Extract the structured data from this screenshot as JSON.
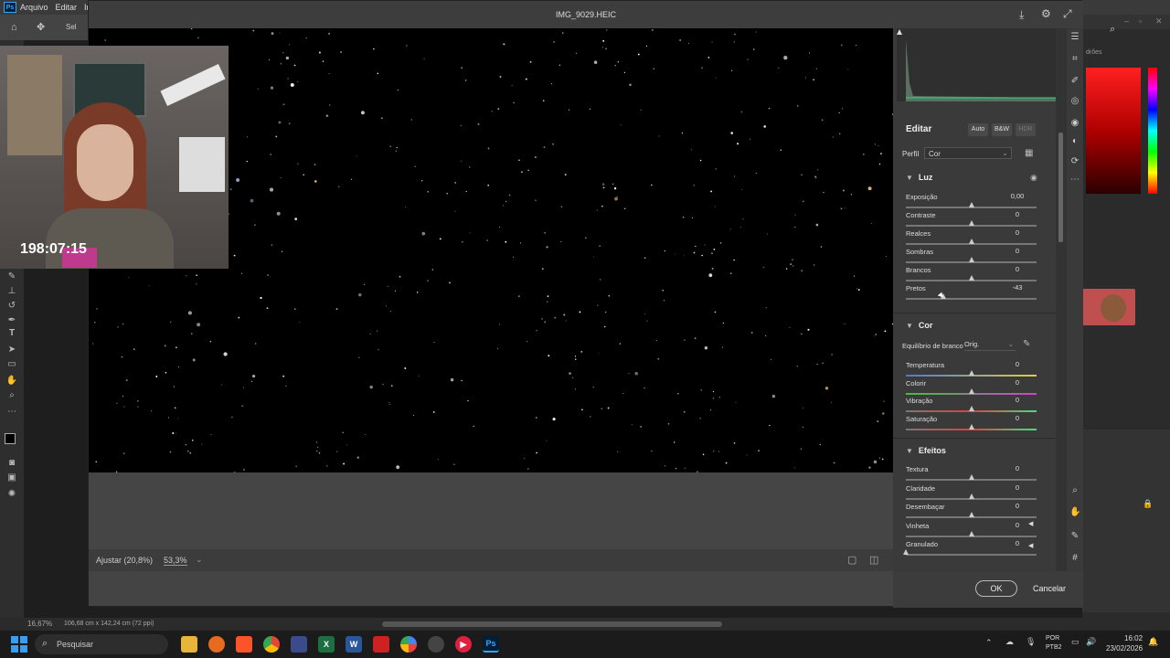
{
  "ps_menu": {
    "logo": "Ps",
    "items": [
      "Arquivo",
      "Editar",
      "Im"
    ]
  },
  "ps_optbar": {
    "sel_label": "Sel"
  },
  "ps_status": {
    "zoom": "16,67%",
    "doc_size": "106,68 cm x 142,24 cm (72 ppi)"
  },
  "dialog": {
    "title": "IMG_9029.HEIC",
    "zoom_fit": "Ajustar (20,8%)",
    "zoom_value": "53,3%",
    "ok_label": "OK",
    "cancel_label": "Cancelar"
  },
  "edit_panel": {
    "title": "Editar",
    "buttons": [
      "Auto",
      "B&W",
      "HDR"
    ],
    "profile_label": "Perfil",
    "profile_value": "Cor",
    "sections": [
      {
        "title": "Luz",
        "sliders": [
          {
            "label": "Exposição",
            "value": "0,00",
            "pos": 0.5
          },
          {
            "label": "Contraste",
            "value": "0",
            "pos": 0.5
          },
          {
            "label": "Realces",
            "value": "0",
            "pos": 0.5
          },
          {
            "label": "Sombras",
            "value": "0",
            "pos": 0.5
          },
          {
            "label": "Brancos",
            "value": "0",
            "pos": 0.5
          },
          {
            "label": "Pretos",
            "value": "-43",
            "pos": 0.285
          }
        ]
      },
      {
        "title": "Cor",
        "wb_label": "Equilíbrio de branco",
        "wb_value": "Orig.",
        "sliders": [
          {
            "label": "Temperatura",
            "value": "0",
            "pos": 0.5
          },
          {
            "label": "Colorir",
            "value": "0",
            "pos": 0.5
          },
          {
            "label": "Vibração",
            "value": "0",
            "pos": 0.5
          },
          {
            "label": "Saturação",
            "value": "0",
            "pos": 0.5
          }
        ]
      },
      {
        "title": "Efeitos",
        "sliders": [
          {
            "label": "Textura",
            "value": "0",
            "pos": 0.5
          },
          {
            "label": "Claridade",
            "value": "0",
            "pos": 0.5
          },
          {
            "label": "Desembaçar",
            "value": "0",
            "pos": 0.5
          },
          {
            "label": "Vinheta",
            "value": "0",
            "pos": 0.5
          },
          {
            "label": "Granulado",
            "value": "0",
            "pos": 0.0
          }
        ]
      }
    ]
  },
  "webcam": {
    "timer": "198:07:15"
  },
  "right_panel": {
    "label": "drões"
  },
  "taskbar": {
    "search_placeholder": "Pesquisar",
    "lang_top": "POR",
    "lang_bottom": "PTB2",
    "time": "16:02",
    "date": "23/02/2026"
  },
  "colors": {
    "accent": "#1473e6",
    "ps_blue": "#31a8ff"
  }
}
